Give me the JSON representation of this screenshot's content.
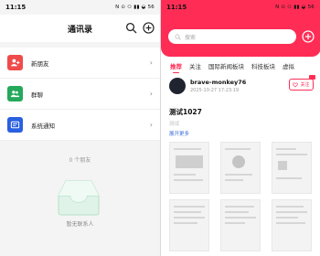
{
  "left": {
    "status": {
      "time": "11:15",
      "icons": "N ⊙ ⚇ ▮▮ ◒ 56"
    },
    "header": {
      "title": "通讯录"
    },
    "menu": [
      {
        "label": "新朋友",
        "color": "#ef4b4b",
        "icon": "add-person-icon"
      },
      {
        "label": "群聊",
        "color": "#25a85c",
        "icon": "group-icon"
      },
      {
        "label": "系统通知",
        "color": "#2a5fe0",
        "icon": "notification-icon"
      }
    ],
    "friend_count": "0 个朋友",
    "empty_text": "暂无联系人"
  },
  "right": {
    "status": {
      "time": "11:15",
      "icons": "N ⊙ ⚇ ▮▮ ◒ 56"
    },
    "accent": "#ff2d55",
    "search": {
      "placeholder": "搜索"
    },
    "tabs": [
      "推荐",
      "关注",
      "国际新闻板块",
      "科技板块",
      "虚拟"
    ],
    "active_tab": "推荐",
    "post": {
      "user": "brave-monkey76",
      "date": "2025-10-27 17:23:19",
      "follow": "关注",
      "title": "测试1027",
      "subtitle": "测试",
      "expand": "展开更多"
    }
  }
}
